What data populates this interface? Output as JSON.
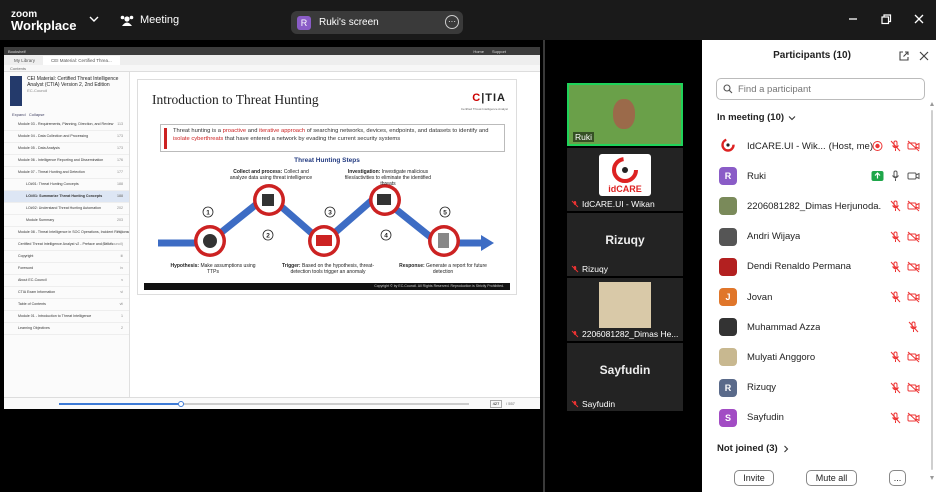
{
  "topbar": {
    "logo_line1": "zoom",
    "logo_line2": "Workplace",
    "meeting_label": "Meeting",
    "screen_avatar": "R",
    "screen_label": "Ruki's screen"
  },
  "viewer": {
    "app_name": "Bookshelf",
    "top_links": [
      "Home",
      "Support"
    ],
    "tabs": [
      "My Library",
      "CEI Material: Certified Threa..."
    ],
    "toolbar_label": "Contents",
    "book_title": "CEI Material: Certified Threat Intelligence Analyst (CTIA) Version 2, 2nd Edition",
    "book_publisher": "EC-Council",
    "toc_controls": [
      "Expand",
      "Collapse"
    ],
    "toc": [
      {
        "label": "Module 03 - Requirements, Planning, Direction, and Review",
        "page": "113"
      },
      {
        "label": "Module 04 - Data Collection and Processing",
        "page": "173"
      },
      {
        "label": "Module 05 - Data Analysis",
        "page": "173"
      },
      {
        "label": "Module 06 - Intelligence Reporting and Dissemination",
        "page": "176"
      },
      {
        "label": "Module 07 - Threat Hunting and Detection",
        "page": "177"
      },
      {
        "label": "LO#01: Threat Hunting Concepts",
        "page": "188"
      },
      {
        "label": "LO#01: Summarize Threat Hunting Concepts",
        "page": "188"
      },
      {
        "label": "LO#02: Understand Threat Hunting Automation",
        "page": "202"
      },
      {
        "label": "Module Summary",
        "page": "203"
      },
      {
        "label": "Module 08 - Threat Intelligence in SOC Operations, Incident Response, and Risk Management",
        "page": "205"
      },
      {
        "label": "Certified Threat Intelligence Analyst v2 - Preface and Series",
        "page": "(EC-Council)"
      },
      {
        "label": "Copyright",
        "page": "iii"
      },
      {
        "label": "Foreword",
        "page": "iv"
      },
      {
        "label": "About EC-Council",
        "page": "v"
      },
      {
        "label": "CTIA Exam Information",
        "page": "vi"
      },
      {
        "label": "Table of Contents",
        "page": "vii"
      },
      {
        "label": "Module 01 - Introduction to Threat Intelligence",
        "page": "1"
      },
      {
        "label": "Learning Objectives",
        "page": "2"
      }
    ],
    "page_current": "427",
    "page_total": "/ 557"
  },
  "slide": {
    "title": "Introduction to Threat Hunting",
    "logo": "CTIA",
    "logo_sub": "Certified Threat Intelligence Analyst",
    "description_parts": {
      "p1": "Threat hunting is a ",
      "h1": "proactive",
      "p2": " and ",
      "h2": "iterative approach",
      "p3": " of searching networks, devices, endpoints, and datasets to identify and ",
      "h3": "isolate cyberthreats",
      "p4": " that have entered a network by evading the current security systems"
    },
    "steps_title": "Threat Hunting Steps",
    "steps": [
      {
        "num": "1",
        "head": "Hypothesis:",
        "text": "Make assumptions using TTPs"
      },
      {
        "num": "2",
        "head": "Collect and process:",
        "text": "Collect and analyze data using threat intelligence"
      },
      {
        "num": "3",
        "head": "Trigger:",
        "text": "Based on the hypothesis, threat-detection tools trigger an anomaly"
      },
      {
        "num": "4",
        "head": "Investigation:",
        "text": "Investigate malicious files/activities to eliminate the identified threats"
      },
      {
        "num": "5",
        "head": "Response:",
        "text": "Generate a report for future detection"
      }
    ],
    "footer": "Copyright © by EC-Council. All Rights Reserved. Reproduction is Strictly Prohibited."
  },
  "tiles": [
    {
      "name": "Ruki"
    },
    {
      "name": "IdCARE.UI - Wikan",
      "logo_text": "idCARE"
    },
    {
      "name": "Rizuqy",
      "big": "Rizuqy"
    },
    {
      "name": "2206081282_Dimas He..."
    },
    {
      "name": "Sayfudin",
      "big": "Sayfudin"
    }
  ],
  "panel": {
    "title": "Participants (10)",
    "find_placeholder": "Find a participant",
    "in_meeting": "In meeting (10)",
    "not_joined": "Not joined (3)",
    "participants": [
      {
        "name": "IdCARE.UI - Wik...",
        "suffix": "(Host, me)",
        "avatar": "",
        "color": "#ffffff"
      },
      {
        "name": "Ruki",
        "suffix": "",
        "avatar": "R",
        "color": "#8a5cc7"
      },
      {
        "name": "2206081282_Dimas Herjunoda...",
        "suffix": "",
        "avatar": "",
        "color": "#7a8a5a"
      },
      {
        "name": "Andri Wijaya",
        "suffix": "",
        "avatar": "",
        "color": "#555555"
      },
      {
        "name": "Dendi Renaldo Permana",
        "suffix": "",
        "avatar": "",
        "color": "#b32020"
      },
      {
        "name": "Jovan",
        "suffix": "",
        "avatar": "J",
        "color": "#e0762a"
      },
      {
        "name": "Muhammad Azza",
        "suffix": "",
        "avatar": "",
        "color": "#333333"
      },
      {
        "name": "Mulyati Anggoro",
        "suffix": "",
        "avatar": "",
        "color": "#c8b890"
      },
      {
        "name": "Rizuqy",
        "suffix": "",
        "avatar": "R",
        "color": "#5a6a8a"
      },
      {
        "name": "Sayfudin",
        "suffix": "",
        "avatar": "S",
        "color": "#a24cc4"
      }
    ],
    "invite_label": "Invite",
    "muteall_label": "Mute all",
    "more_label": "..."
  }
}
